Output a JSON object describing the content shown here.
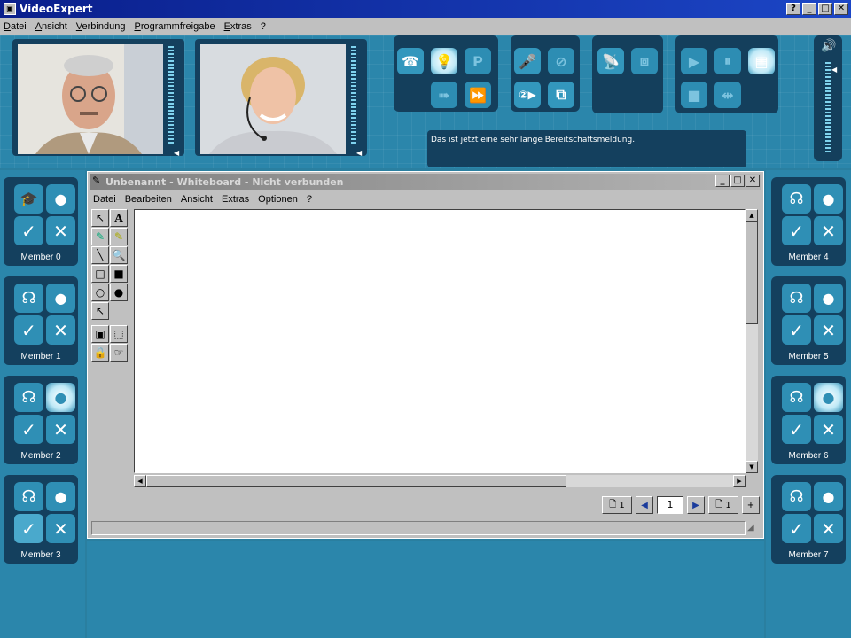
{
  "app": {
    "title": "VideoExpert"
  },
  "window_buttons": [
    "?",
    "_",
    "□",
    "✕"
  ],
  "menu": [
    "Datei",
    "Ansicht",
    "Verbindung",
    "Programmfreigabe",
    "Extras",
    "?"
  ],
  "toolbar": {
    "group1": [
      "phone-icon",
      "bulb-icon",
      "P"
    ],
    "group1_row2": [
      "arrow-icon",
      "fast-forward-icon"
    ],
    "group2": [
      "microphone-icon",
      "camera-off-icon",
      "camera-2-icon",
      "window-icon"
    ],
    "group3": [
      "network-icon",
      "share-icon"
    ],
    "group4": [
      "play-icon",
      "pause-icon",
      "note-icon",
      "stop-icon",
      "swap-icon"
    ]
  },
  "status_message": "Das ist jetzt eine sehr lange Bereitschaftsmeldung.",
  "members_left": [
    {
      "label": "Member 0",
      "icon": "graduation-cap-icon"
    },
    {
      "label": "Member 1",
      "icon": "headset-icon"
    },
    {
      "label": "Member 2",
      "icon": "headset-icon"
    },
    {
      "label": "Member 3",
      "icon": "headset-icon"
    }
  ],
  "members_right": [
    {
      "label": "Member 4",
      "icon": "headset-icon"
    },
    {
      "label": "Member 5",
      "icon": "headset-icon"
    },
    {
      "label": "Member 6",
      "icon": "headset-icon"
    },
    {
      "label": "Member 7",
      "icon": "headset-icon"
    }
  ],
  "whiteboard": {
    "title": "Unbenannt - Whiteboard - Nicht verbunden",
    "menu": [
      "Datei",
      "Bearbeiten",
      "Ansicht",
      "Extras",
      "Optionen",
      "?"
    ],
    "page_current": "1",
    "page_left_count": "1",
    "page_right_count": "1"
  },
  "glyphs": {
    "check": "✓",
    "cross": "✕",
    "speech": "💬"
  }
}
